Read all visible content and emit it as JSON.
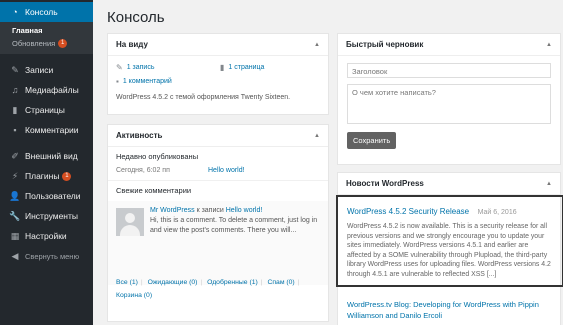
{
  "sidebar": {
    "items": [
      {
        "label": "Консоль",
        "icon": "dashboard-icon",
        "current": true
      },
      {
        "label": "Записи",
        "icon": "pin-icon"
      },
      {
        "label": "Медиафайлы",
        "icon": "media-icon"
      },
      {
        "label": "Страницы",
        "icon": "pages-icon"
      },
      {
        "label": "Комментарии",
        "icon": "comment-icon"
      },
      {
        "label": "Внешний вид",
        "icon": "brush-icon"
      },
      {
        "label": "Плагины",
        "icon": "plugin-icon",
        "badge": "1"
      },
      {
        "label": "Пользователи",
        "icon": "users-icon"
      },
      {
        "label": "Инструменты",
        "icon": "wrench-icon"
      },
      {
        "label": "Настройки",
        "icon": "settings-icon"
      }
    ],
    "submenu": [
      {
        "label": "Главная"
      },
      {
        "label": "Обновления",
        "badge": "1"
      }
    ],
    "collapse_label": "Свернуть меню"
  },
  "page_title": "Консоль",
  "glance": {
    "title": "На виду",
    "posts": "1 запись",
    "pages": "1 страница",
    "comments": "1 комментарий",
    "version_text": "WordPress 4.5.2 с темой оформления Twenty Sixteen."
  },
  "activity": {
    "title": "Активность",
    "recent_label": "Недавно опубликованы",
    "pub_date": "Сегодня, 6:02 пп",
    "pub_link": "Hello world!",
    "comments_label": "Свежие комментарии",
    "comment_author": "Mr WordPress",
    "comment_on": "к записи",
    "comment_post": "Hello world!",
    "comment_excerpt": "Hi, this is a comment. To delete a comment, just log in and view the post's comments. There you will...",
    "filters": {
      "all": "Все (1)",
      "pending": "Ожидающие (0)",
      "approved": "Одобренные (1)",
      "spam": "Спам (0)",
      "trash": "Корзина (0)"
    }
  },
  "draft": {
    "title": "Быстрый черновик",
    "title_placeholder": "Заголовок",
    "content_placeholder": "О чем хотите написать?",
    "save_label": "Сохранить"
  },
  "news": {
    "title": "Новости WordPress",
    "item1_title": "WordPress 4.5.2 Security Release",
    "item1_date": "Май 6, 2016",
    "item1_excerpt": "WordPress 4.5.2 is now available. This is a security release for all previous versions and we strongly encourage you to update your sites immediately. WordPress versions 4.5.1 and earlier are affected by a SOME vulnerability through Plupload, the third-party library WordPress uses for uploading files. WordPress versions 4.2 through 4.5.1 are vulnerable to reflected XSS [...]",
    "item2_title": "WordPress.tv Blog: Developing for WordPress with Pippin Williamson and Danilo Ercoli"
  },
  "colors": {
    "sidebar_bg": "#23282d",
    "accent": "#0073aa",
    "badge": "#d54e21"
  }
}
